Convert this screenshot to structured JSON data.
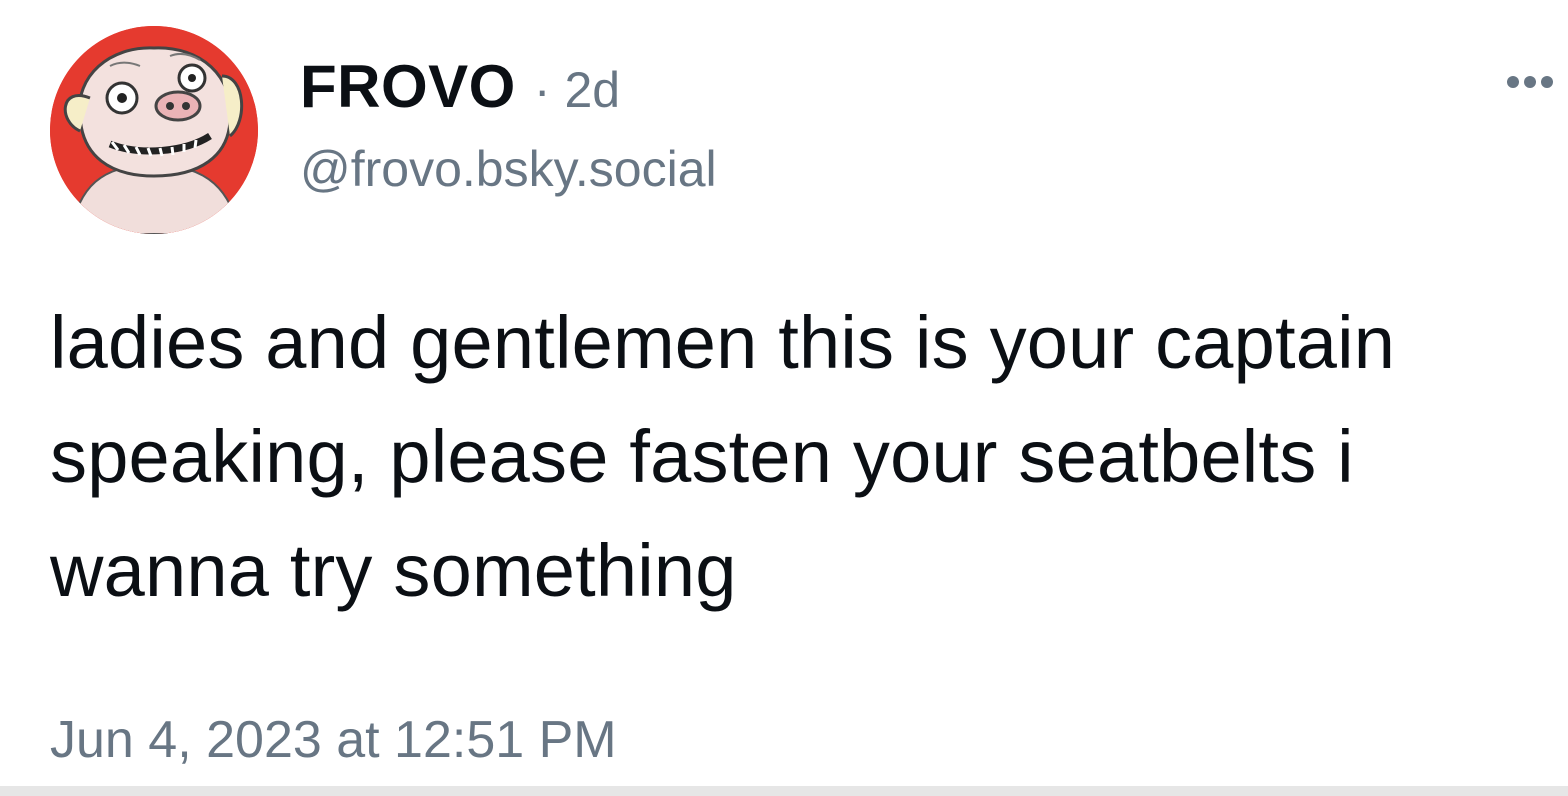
{
  "post": {
    "author": {
      "display_name": "FROVO",
      "separator": "·",
      "age": "2d",
      "handle": "@frovo.bsky.social"
    },
    "text": "ladies and gentlemen this is your captain speaking, please fasten your seatbelts i wanna try something",
    "timestamp": "Jun 4, 2023 at 12:51 PM",
    "more_icon": "ellipsis-horizontal-icon"
  },
  "colors": {
    "text_primary": "#0b0f14",
    "text_secondary": "#687684",
    "avatar_background": "#e53a2f"
  }
}
